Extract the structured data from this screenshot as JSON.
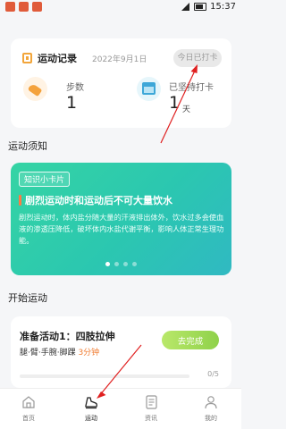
{
  "status_bar": {
    "time": "15:37"
  },
  "record": {
    "title": "运动记录",
    "date": "2022年9月1日",
    "checkin_label": "今日已打卡",
    "steps_label": "步数",
    "steps_value": "1",
    "days_label": "已坚持打卡",
    "days_value": "1",
    "days_unit": "天"
  },
  "notice": {
    "section_title": "运动须知",
    "tag": "知识小卡片",
    "title": "剧烈运动时和运动后不可大量饮水",
    "body": "剧烈运动时，体内盐分随大量的汗液排出体外，饮水过多会使血液的渗透压降低，破坏体内水盐代谢平衡，影响人体正常生理功能。",
    "slide_index": 1,
    "slide_count": 4
  },
  "start": {
    "section_title": "开始运动",
    "exercise_title": "准备活动1：四肢拉伸",
    "exercise_parts": "腿·臂·手腕·脚踝 ",
    "exercise_minutes": "3分钟",
    "go_label": "去完成",
    "progress_text": "0/5",
    "progress_fraction": 0
  },
  "nav": {
    "items": [
      {
        "label": "首页",
        "icon": "home-icon"
      },
      {
        "label": "运动",
        "icon": "sneaker-icon",
        "active": true
      },
      {
        "label": "资讯",
        "icon": "news-icon"
      },
      {
        "label": "我的",
        "icon": "profile-icon"
      }
    ]
  },
  "colors": {
    "accent_green": "#8fd14a",
    "banner_teal": "#2bc7b0",
    "annotation_red": "#e02020",
    "orange": "#f4a23c"
  }
}
